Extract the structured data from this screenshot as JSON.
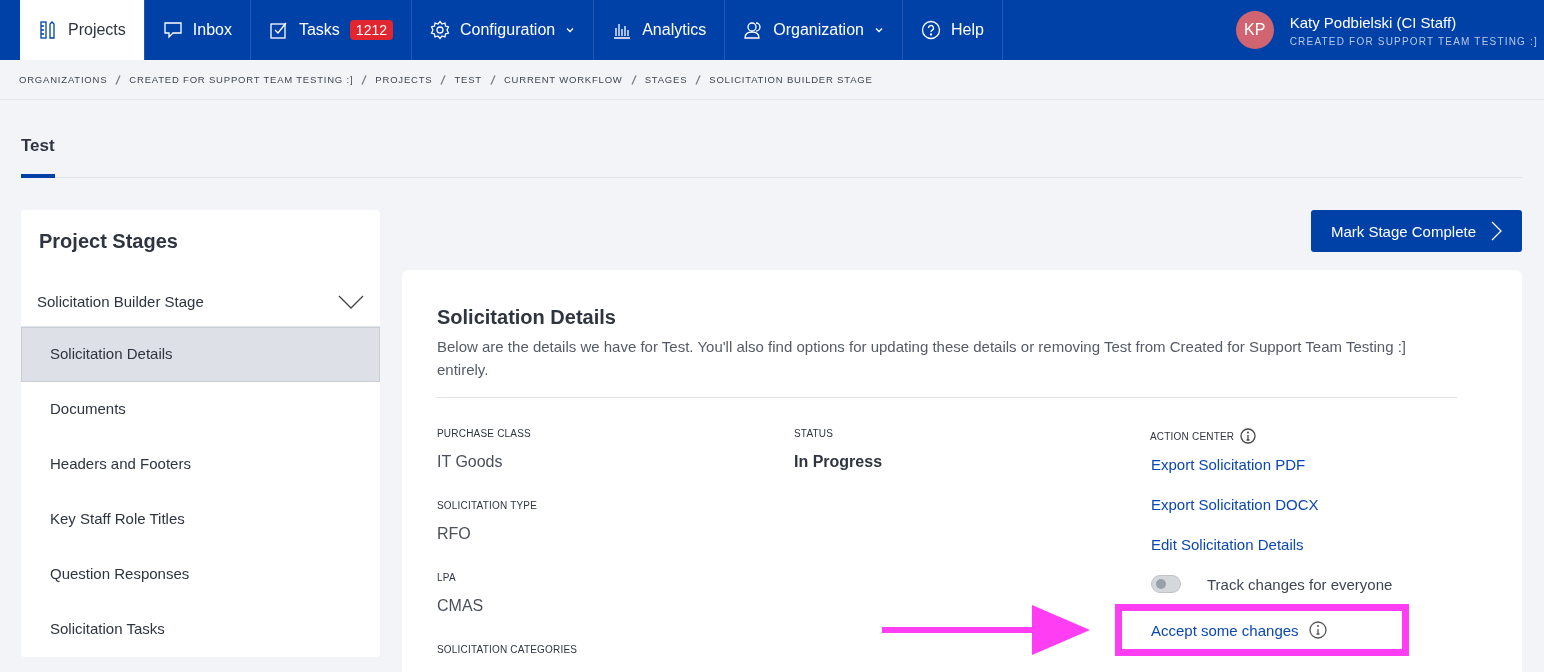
{
  "nav": {
    "items": [
      {
        "label": "Projects",
        "selected": true
      },
      {
        "label": "Inbox",
        "selected": false
      },
      {
        "label": "Tasks",
        "badge": "1212",
        "selected": false
      },
      {
        "label": "Configuration",
        "dropdown": true,
        "selected": false
      },
      {
        "label": "Analytics",
        "selected": false
      },
      {
        "label": "Organization",
        "dropdown": true,
        "selected": false
      },
      {
        "label": "Help",
        "selected": false
      }
    ],
    "user": {
      "initials": "KP",
      "name": "Katy Podbielski (CI Staff)",
      "organization": "CREATED FOR SUPPORT TEAM TESTING :]"
    }
  },
  "breadcrumbs": [
    "ORGANIZATIONS",
    "CREATED FOR SUPPORT TEAM TESTING :]",
    "PROJECTS",
    "TEST",
    "CURRENT WORKFLOW",
    "STAGES",
    "SOLICITATION BUILDER STAGE"
  ],
  "page_tabs": [
    {
      "label": "Test",
      "selected": true
    }
  ],
  "sidebar": {
    "title": "Project Stages",
    "stages": [
      {
        "label": "Solicitation Builder Stage",
        "expanded": true,
        "children": [
          {
            "label": "Solicitation Details",
            "selected": true
          },
          {
            "label": "Documents",
            "selected": false
          },
          {
            "label": "Headers and Footers",
            "selected": false
          },
          {
            "label": "Key Staff Role Titles",
            "selected": false
          },
          {
            "label": "Question Responses",
            "selected": false
          },
          {
            "label": "Solicitation Tasks",
            "selected": false
          }
        ]
      }
    ]
  },
  "complete_button": "Mark Stage Complete",
  "details": {
    "title": "Solicitation Details",
    "description": "Below are the details we have for Test. You'll also find options for updating these details or removing Test from Created for Support Team Testing :] entirely.",
    "fields_left": [
      {
        "label": "PURCHASE CLASS",
        "value": "IT Goods"
      },
      {
        "label": "SOLICITATION TYPE",
        "value": "RFO"
      },
      {
        "label": "LPA",
        "value": "CMAS"
      },
      {
        "label": "SOLICITATION CATEGORIES"
      }
    ],
    "fields_middle": [
      {
        "label": "STATUS",
        "value": "In Progress"
      }
    ],
    "action_center": {
      "label": "ACTION CENTER",
      "actions": [
        {
          "kind": "link",
          "label": "Export Solicitation PDF",
          "highlighted": false
        },
        {
          "kind": "link",
          "label": "Export Solicitation DOCX",
          "highlighted": false
        },
        {
          "kind": "link",
          "label": "Edit Solicitation Details",
          "highlighted": false
        },
        {
          "kind": "toggle",
          "label": "Track changes for everyone",
          "on": false,
          "highlighted": false
        },
        {
          "kind": "link",
          "label": "Accept some changes",
          "info": true,
          "highlighted": true
        }
      ]
    }
  }
}
